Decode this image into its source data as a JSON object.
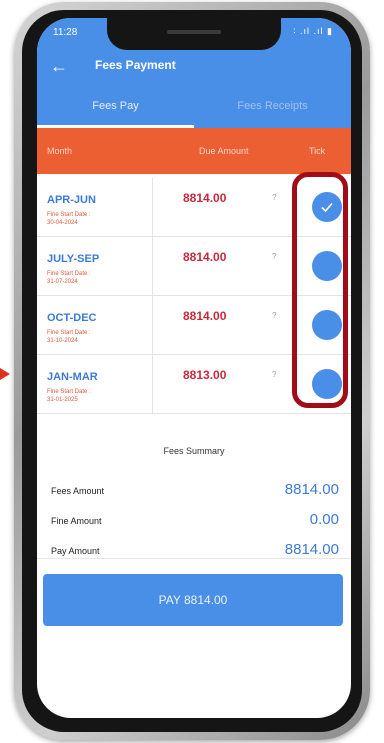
{
  "status": {
    "time": "11:28",
    "icons": "∶ .ıl .ıl ▮"
  },
  "header": {
    "title": "Fees Payment"
  },
  "tabs": [
    {
      "label": "Fees Pay"
    },
    {
      "label": "Fees Receipts"
    }
  ],
  "table": {
    "headers": {
      "month": "Month",
      "due": "Due Amount",
      "tick": "Tick"
    },
    "rows": [
      {
        "month": "APR-JUN",
        "fine_label": "Fine Start Date :",
        "fine_date": "30-04-2024",
        "amount": "8814.00",
        "info": "?",
        "checked": true
      },
      {
        "month": "JULY-SEP",
        "fine_label": "Fine Start Date :",
        "fine_date": "31-07-2024",
        "amount": "8814.00",
        "info": "?",
        "checked": false
      },
      {
        "month": "OCT-DEC",
        "fine_label": "Fine Start Date :",
        "fine_date": "31-10-2024",
        "amount": "8814.00",
        "info": "?",
        "checked": false
      },
      {
        "month": "JAN-MAR",
        "fine_label": "Fine Start Date :",
        "fine_date": "31-01-2025",
        "amount": "8813.00",
        "info": "?",
        "checked": false
      }
    ]
  },
  "summary": {
    "title": "Fees Summary",
    "fees_amount_label": "Fees Amount",
    "fees_amount": "8814.00",
    "fine_amount_label": "Fine Amount",
    "fine_amount": "0.00",
    "pay_amount_label": "Pay Amount",
    "pay_amount": "8814.00"
  },
  "pay_button": {
    "label": "PAY 8814.00"
  },
  "icons": {
    "back": "arrow-left",
    "tick": "check-mark"
  },
  "colors": {
    "header": "#4a8fe7",
    "table_header": "#ec5f33",
    "amount": "#c8293a",
    "highlight": "#a00d16"
  }
}
